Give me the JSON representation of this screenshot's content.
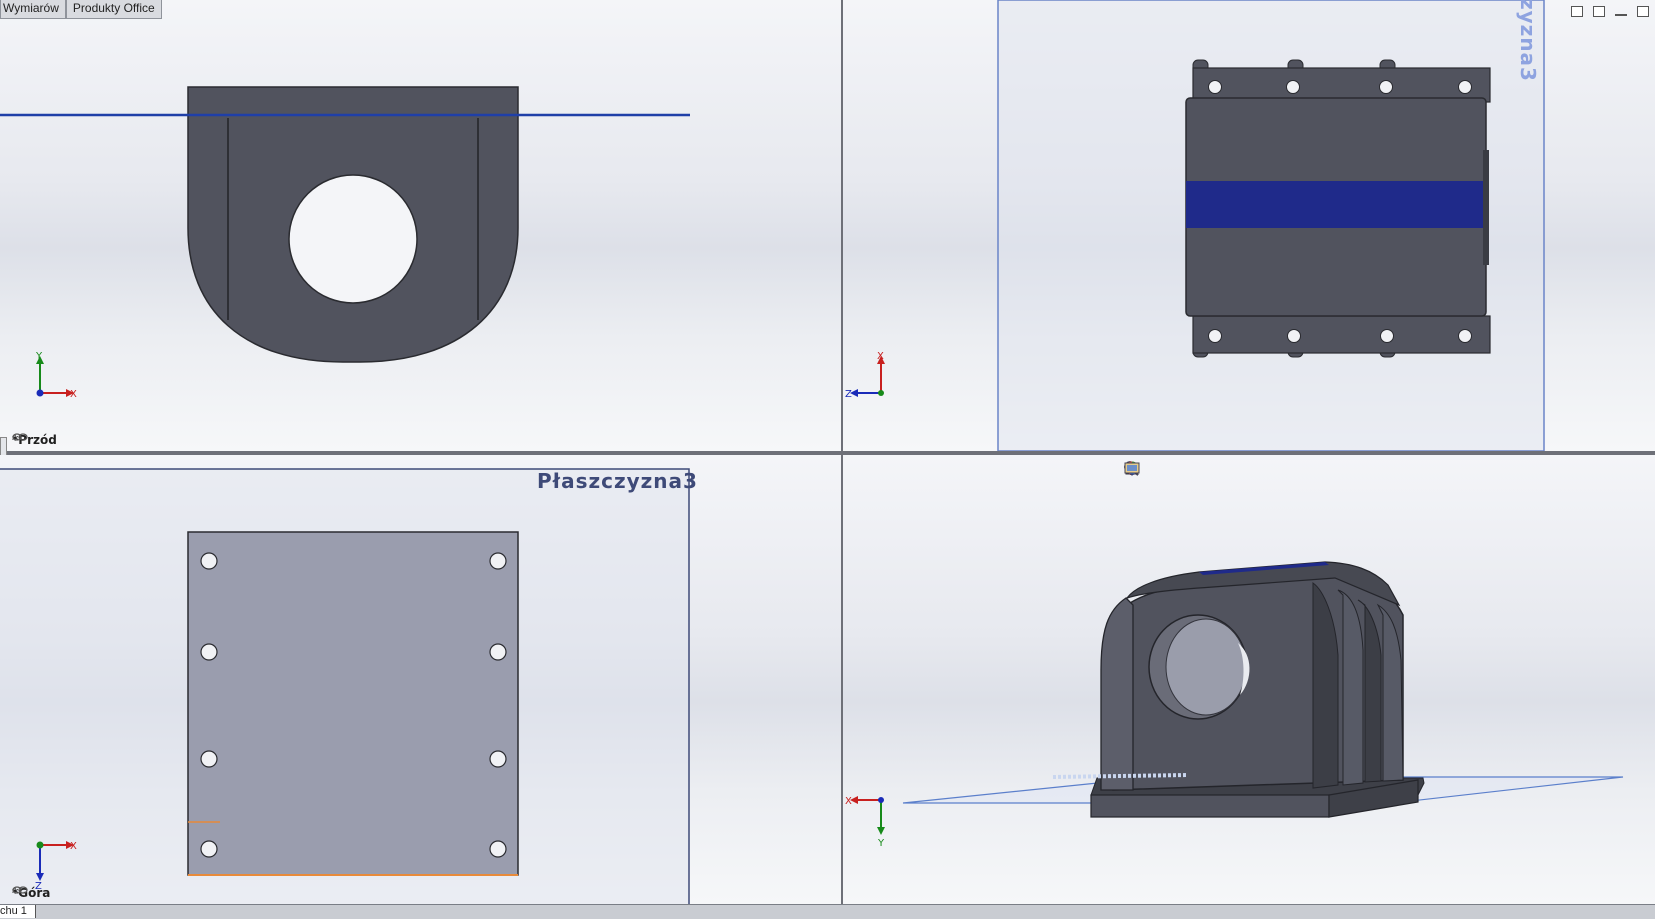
{
  "tabs": [
    "Wymiarów",
    "Produkty Office"
  ],
  "views": {
    "front": {
      "label": "*Przód",
      "axes": [
        "Y",
        "X"
      ]
    },
    "right": {
      "plane": "zyzna3",
      "axes": [
        "X",
        "Z"
      ]
    },
    "top": {
      "label": "*Góra",
      "plane": "Płaszczyzna3",
      "axes": [
        "X",
        "Z"
      ]
    },
    "iso": {
      "axes": [
        "X",
        "Y"
      ]
    }
  },
  "bottom": {
    "sheet_tab": "chu 1"
  },
  "icons": [
    "zoom-to-fit-icon",
    "zoom-area-icon",
    "previous-view-icon",
    "section-view-icon",
    "view-orientation-icon",
    "display-style-icon",
    "hide-show-icon",
    "edit-appearance-icon",
    "apply-scene-icon",
    "view-settings-icon"
  ],
  "colors": {
    "part": "#51535e",
    "part_light": "#9a9dae",
    "selection": "#1f2a8a",
    "plane": "#4a6fc0",
    "axis_x": "#c8201f",
    "axis_y": "#178a1a",
    "axis_z": "#1a2bb8"
  }
}
